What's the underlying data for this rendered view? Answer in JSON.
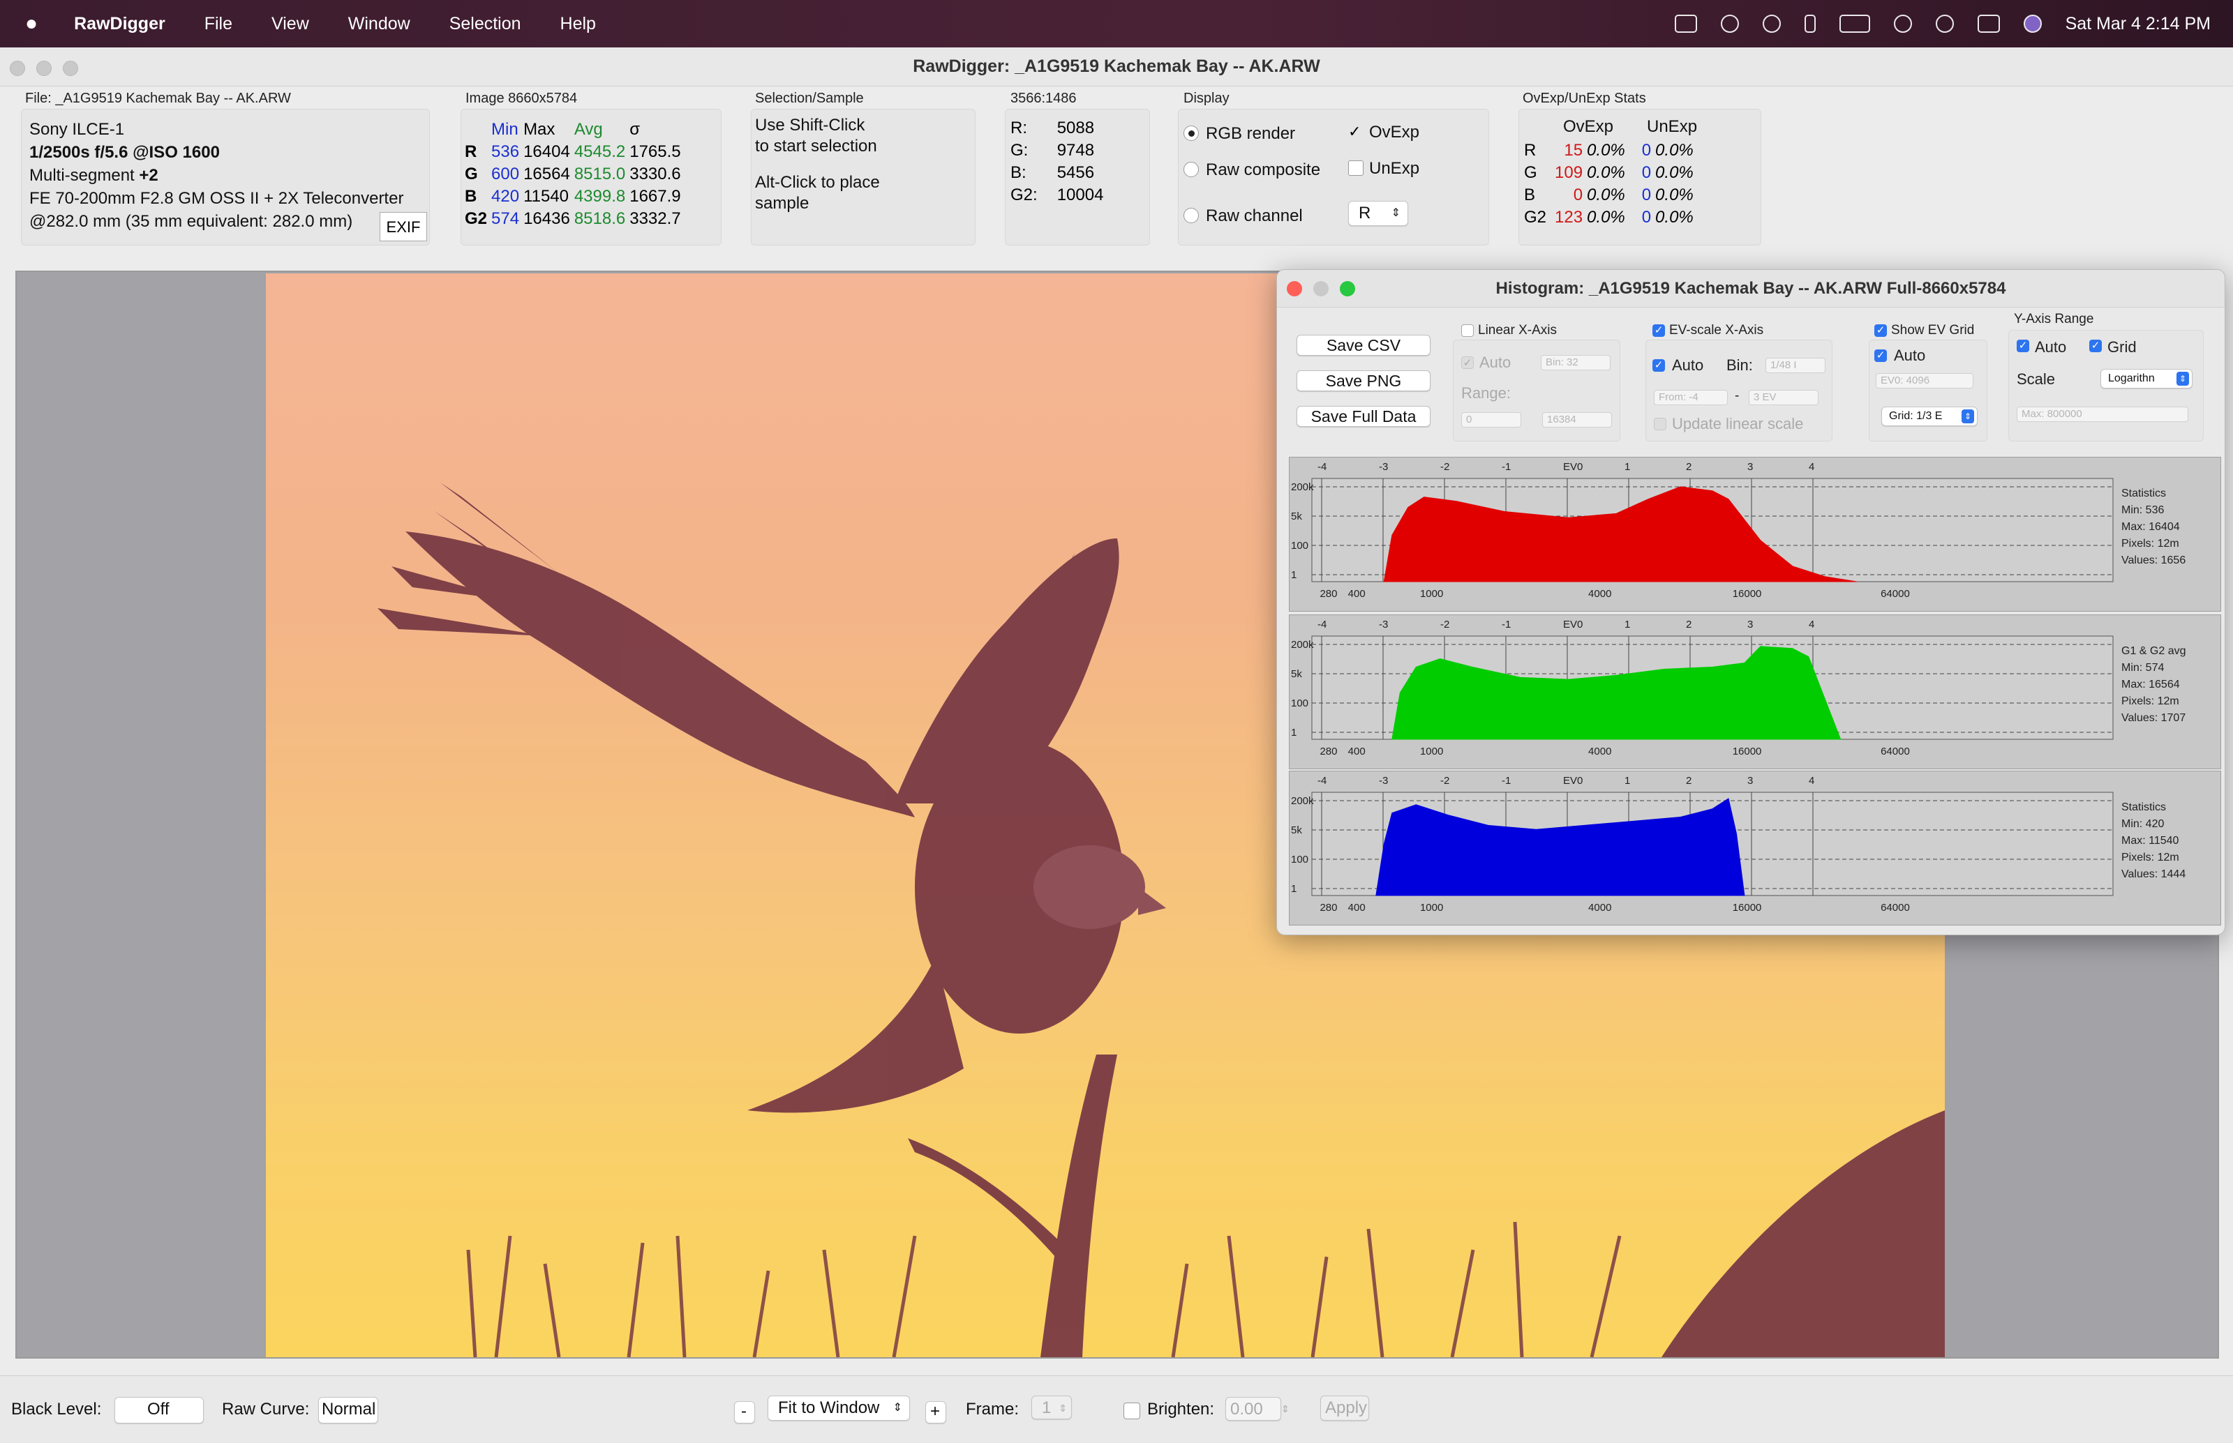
{
  "menubar": {
    "app": "RawDigger",
    "items": [
      "File",
      "View",
      "Window",
      "Selection",
      "Help"
    ],
    "clock": "Sat Mar 4  2:14 PM"
  },
  "window": {
    "title": "RawDigger: _A1G9519  Kachemak Bay -- AK.ARW"
  },
  "file": {
    "header": "File: _A1G9519  Kachemak Bay -- AK.ARW",
    "camera": "Sony ILCE-1",
    "exposure": "1/2500s f/5.6 @ISO 1600",
    "metering_label": "Multi-segment ",
    "metering_value": "+2",
    "lens": "FE 70-200mm F2.8 GM OSS II + 2X Teleconverter",
    "focal": "@282.0 mm (35 mm equivalent: 282.0 mm)",
    "exif_button": "EXIF"
  },
  "image_stats": {
    "header": "Image 8660x5784",
    "columns": [
      "Min",
      "Max",
      "Avg",
      "σ"
    ],
    "rows": [
      {
        "ch": "R",
        "min": "536",
        "max": "16404",
        "avg": "4545.2",
        "sd": "1765.5"
      },
      {
        "ch": "G",
        "min": "600",
        "max": "16564",
        "avg": "8515.0",
        "sd": "3330.6"
      },
      {
        "ch": "B",
        "min": "420",
        "max": "11540",
        "avg": "4399.8",
        "sd": "1667.9"
      },
      {
        "ch": "G2",
        "min": "574",
        "max": "16436",
        "avg": "8518.6",
        "sd": "3332.7"
      }
    ]
  },
  "selection": {
    "header": "Selection/Sample",
    "line1": "Use Shift-Click",
    "line2": "to start selection",
    "line3": "Alt-Click to place",
    "line4": "sample"
  },
  "sample": {
    "header": "3566:1486",
    "rows": [
      {
        "k": "R:",
        "v": "5088"
      },
      {
        "k": "G:",
        "v": "9748"
      },
      {
        "k": "B:",
        "v": "5456"
      },
      {
        "k": "G2:",
        "v": "10004"
      }
    ]
  },
  "display": {
    "header": "Display",
    "rgb_render": "RGB render",
    "raw_composite": "Raw composite",
    "raw_channel": "Raw channel",
    "ovexp": "OvExp",
    "unexp": "UnExp",
    "channel_value": "R"
  },
  "ovunexp": {
    "header": "OvExp/UnExp Stats",
    "col1": "OvExp",
    "col2": "UnExp",
    "rows": [
      {
        "ch": "R",
        "ov_n": "15",
        "ov_p": "0.0%",
        "un_n": "0",
        "un_p": "0.0%"
      },
      {
        "ch": "G",
        "ov_n": "109",
        "ov_p": "0.0%",
        "un_n": "0",
        "un_p": "0.0%"
      },
      {
        "ch": "B",
        "ov_n": "0",
        "ov_p": "0.0%",
        "un_n": "0",
        "un_p": "0.0%"
      },
      {
        "ch": "G2",
        "ov_n": "123",
        "ov_p": "0.0%",
        "un_n": "0",
        "un_p": "0.0%"
      }
    ]
  },
  "histogram": {
    "title": "Histogram: _A1G9519  Kachemak Bay -- AK.ARW Full-8660x5784",
    "buttons": {
      "save_csv": "Save CSV",
      "save_png": "Save PNG",
      "save_full": "Save Full Data"
    },
    "linear": {
      "label": "Linear X-Axis",
      "auto": "Auto",
      "bin": "Bin: 32",
      "range": "Range:",
      "from": "0",
      "to": "16384"
    },
    "ev": {
      "label": "EV-scale X-Axis",
      "auto": "Auto",
      "bin_label": "Bin:",
      "bin": "1/48 I",
      "from": "From: -4",
      "to": "3 EV",
      "dash": "-",
      "update": "Update linear scale"
    },
    "grid": {
      "label": "Show EV Grid",
      "auto": "Auto",
      "ev0": "EV0: 4096",
      "grid": "Grid: 1/3 E"
    },
    "yaxis": {
      "label": "Y-Axis Range",
      "auto": "Auto",
      "grid": "Grid",
      "scale": "Scale",
      "scale_value": "Logarithn",
      "max": "Max: 800000"
    },
    "ev_ticks": [
      "-4",
      "-3",
      "-2",
      "-1",
      "EV0",
      "1",
      "2",
      "3",
      "4"
    ],
    "y_ticks": [
      "200k",
      "5k",
      "100",
      "1"
    ],
    "x_ticks": [
      "280",
      "400",
      "1000",
      "4000",
      "16000",
      "64000"
    ],
    "panels": [
      {
        "color": "#e00000",
        "stats": [
          "Statistics",
          "Min: 536",
          "Max: 16404",
          "Pixels: 12m",
          "Values: 1656"
        ]
      },
      {
        "color": "#00cc00",
        "stats": [
          "G1 & G2 avg",
          "Min: 574",
          "Max: 16564",
          "Pixels: 12m",
          "Values: 1707"
        ]
      },
      {
        "color": "#0000dd",
        "stats": [
          "Statistics",
          "Min: 420",
          "Max: 11540",
          "Pixels: 12m",
          "Values: 1444"
        ]
      }
    ]
  },
  "bottom": {
    "black_level_label": "Black Level:",
    "black_level_value": "Off",
    "raw_curve_label": "Raw Curve:",
    "raw_curve_value": "Normal",
    "minus": "-",
    "zoom": "Fit to Window",
    "plus": "+",
    "frame_label": "Frame:",
    "frame_value": "1",
    "brighten_label": "Brighten:",
    "brighten_value": "0.00",
    "apply": "Apply"
  }
}
